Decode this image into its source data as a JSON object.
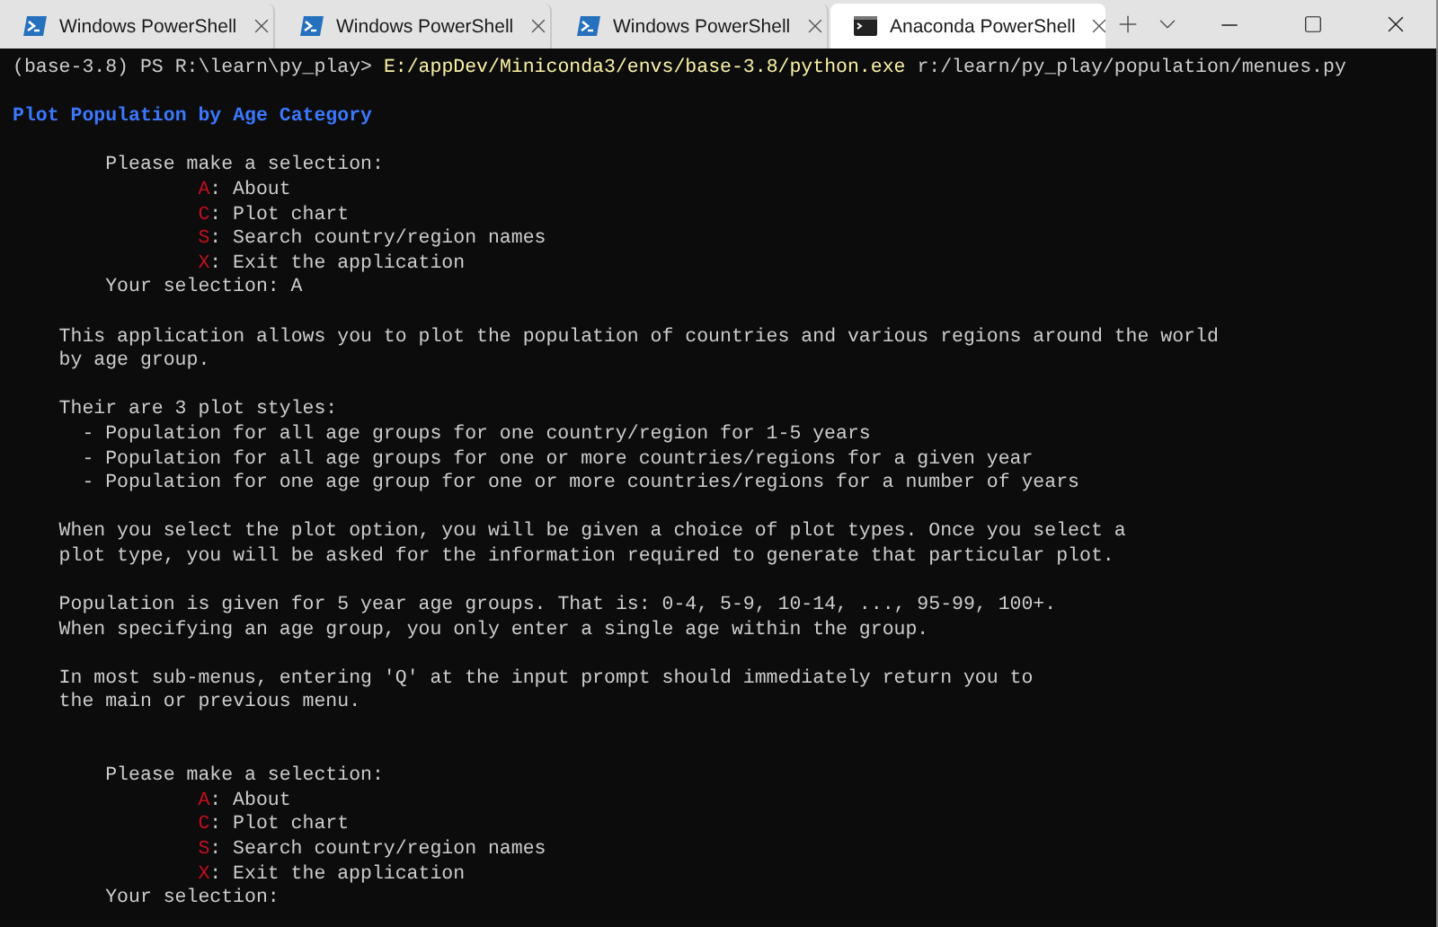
{
  "tabs": [
    {
      "title": "Windows PowerShell",
      "kind": "powershell",
      "selected": false
    },
    {
      "title": "Windows PowerShell",
      "kind": "powershell",
      "selected": false
    },
    {
      "title": "Windows PowerShell",
      "kind": "powershell",
      "selected": false
    },
    {
      "title": "Anaconda PowerShell",
      "kind": "terminal",
      "selected": true
    }
  ],
  "terminal": {
    "lines": [
      {
        "kind": "prompt",
        "prompt": "(base-3.8) PS R:\\learn\\py_play>",
        "command": "E:/appDev/Miniconda3/envs/base-3.8/python.exe",
        "args": "r:/learn/py_play/population/menues.py"
      },
      {
        "kind": "blank"
      },
      {
        "kind": "title",
        "text": "Plot Population by Age Category"
      },
      {
        "kind": "blank"
      },
      {
        "kind": "menu-header",
        "text": "Please make a selection:"
      },
      {
        "kind": "menu-item",
        "key": "A",
        "text": ": About"
      },
      {
        "kind": "menu-item",
        "key": "C",
        "text": ": Plot chart"
      },
      {
        "kind": "menu-item",
        "key": "S",
        "text": ": Search country/region names"
      },
      {
        "kind": "menu-item",
        "key": "X",
        "text": ": Exit the application"
      },
      {
        "kind": "menu-header",
        "text": "Your selection: A"
      },
      {
        "kind": "blank"
      },
      {
        "kind": "text",
        "text": "This application allows you to plot the population of countries and various regions around the world"
      },
      {
        "kind": "text",
        "text": "by age group."
      },
      {
        "kind": "blank"
      },
      {
        "kind": "text",
        "text": "Their are 3 plot styles:"
      },
      {
        "kind": "bullet",
        "text": "- Population for all age groups for one country/region for 1-5 years"
      },
      {
        "kind": "bullet",
        "text": "- Population for all age groups for one or more countries/regions for a given year"
      },
      {
        "kind": "bullet",
        "text": "- Population for one age group for one or more countries/regions for a number of years"
      },
      {
        "kind": "blank"
      },
      {
        "kind": "text",
        "text": "When you select the plot option, you will be given a choice of plot types. Once you select a"
      },
      {
        "kind": "text",
        "text": "plot type, you will be asked for the information required to generate that particular plot."
      },
      {
        "kind": "blank"
      },
      {
        "kind": "text",
        "text": "Population is given for 5 year age groups. That is: 0-4, 5-9, 10-14, ..., 95-99, 100+."
      },
      {
        "kind": "text",
        "text": "When specifying an age group, you only enter a single age within the group."
      },
      {
        "kind": "blank"
      },
      {
        "kind": "text",
        "text": "In most sub-menus, entering 'Q' at the input prompt should immediately return you to"
      },
      {
        "kind": "text",
        "text": "the main or previous menu."
      },
      {
        "kind": "blank"
      },
      {
        "kind": "blank"
      },
      {
        "kind": "menu-header",
        "text": "Please make a selection:"
      },
      {
        "kind": "menu-item",
        "key": "A",
        "text": ": About"
      },
      {
        "kind": "menu-item",
        "key": "C",
        "text": ": Plot chart"
      },
      {
        "kind": "menu-item",
        "key": "S",
        "text": ": Search country/region names"
      },
      {
        "kind": "menu-item",
        "key": "X",
        "text": ": Exit the application"
      },
      {
        "kind": "menu-header",
        "text": "Your selection:"
      }
    ]
  }
}
